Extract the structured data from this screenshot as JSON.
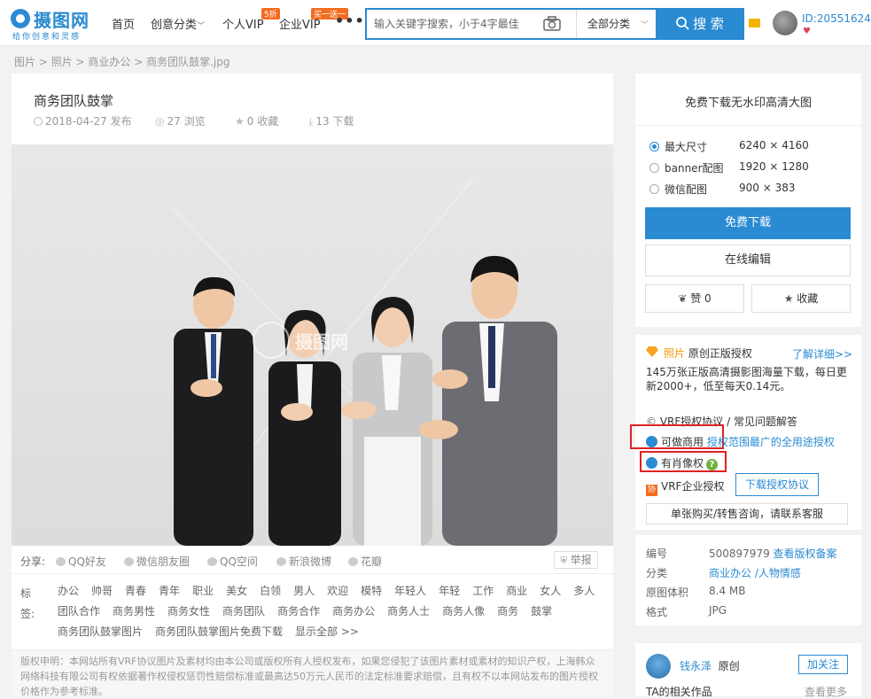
{
  "header": {
    "logo_title": "摄图网",
    "logo_sub": "给你创意和灵感",
    "nav": {
      "home": "首页",
      "creative": "创意分类",
      "personal_vip": "个人VIP",
      "personal_vip_badge": "5折",
      "enterprise_vip": "企业VIP",
      "enterprise_vip_badge": "买一送一",
      "more": "•••"
    },
    "search": {
      "placeholder": "输入关键字搜索，小于4字最佳",
      "category": "全部分类",
      "button": "搜 索"
    },
    "user_id": "ID:20551624"
  },
  "breadcrumb": [
    "图片",
    "照片",
    "商业办公",
    "商务团队鼓掌.jpg"
  ],
  "image": {
    "title": "商务团队鼓掌",
    "date": "2018-04-27 发布",
    "views": "27 浏览",
    "favorites": "0 收藏",
    "downloads": "13 下载",
    "watermark": "摄图网"
  },
  "share": {
    "label": "分享:",
    "items": [
      "QQ好友",
      "微信朋友圈",
      "QQ空间",
      "新浪微博",
      "花瓣"
    ],
    "report": "举报"
  },
  "tags": {
    "label": "标签:",
    "items": [
      "办公",
      "帅哥",
      "青春",
      "青年",
      "职业",
      "美女",
      "白领",
      "男人",
      "欢迎",
      "模特",
      "年轻人",
      "年轻",
      "工作",
      "商业",
      "女人",
      "多人",
      "团队合作",
      "商务男性",
      "商务女性",
      "商务团队",
      "商务合作",
      "商务办公",
      "商务人士",
      "商务人像",
      "商务",
      "鼓掌",
      "商务团队鼓掌图片",
      "商务团队鼓掌图片免费下载",
      "显示全部 >>"
    ]
  },
  "copyright": "版权申明：本网站所有VRF协议图片及素材均由本公司或版权所有人授权发布，如果您侵犯了该图片素材或素材的知识产权，上海韩众网络科技有限公司有权依据著作权侵权惩罚性赔偿标准或最高达50万元人民币的法定标准要求赔偿，且有权不以本网站发布的图片授权价格作为参考标准。",
  "download": {
    "title": "免费下载无水印高清大图",
    "sizes": [
      {
        "label": "最大尺寸",
        "value": "6240 × 4160"
      },
      {
        "label": "banner配图",
        "value": "1920 × 1280"
      },
      {
        "label": "微信配图",
        "value": "900 × 383"
      }
    ],
    "free_download": "免费下载",
    "edit_online": "在线编辑",
    "like": "赞 0",
    "favorite": "收藏"
  },
  "license": {
    "type_label": "照片",
    "type_desc": "原创正版授权",
    "learn_more": "了解详细>>",
    "desc": "145万张正版高清摄影图海量下载，每日更新2000+，低至每天0.14元。",
    "vrf": "VRF授权协议",
    "faq": "常见问题解答",
    "commercial": "可做商用",
    "commercial_scope": "授权范围最广的全用途授权",
    "portrait": "有肖像权",
    "enterprise": "VRF企业授权",
    "download_agreement": "下载授权协议",
    "buy": "单张购买/转售咨询，请联系客服"
  },
  "info": {
    "rows": [
      {
        "label": "编号",
        "value": "500897979",
        "extra": "查看版权备案"
      },
      {
        "label": "分类",
        "value": "商业办公 /人物情感"
      },
      {
        "label": "原图体积",
        "value": "8.4 MB"
      },
      {
        "label": "格式",
        "value": "JPG"
      }
    ]
  },
  "author": {
    "name": "钱永泽",
    "tag": "原创",
    "follow": "加关注",
    "related": "TA的相关作品",
    "see_more": "查看更多"
  }
}
